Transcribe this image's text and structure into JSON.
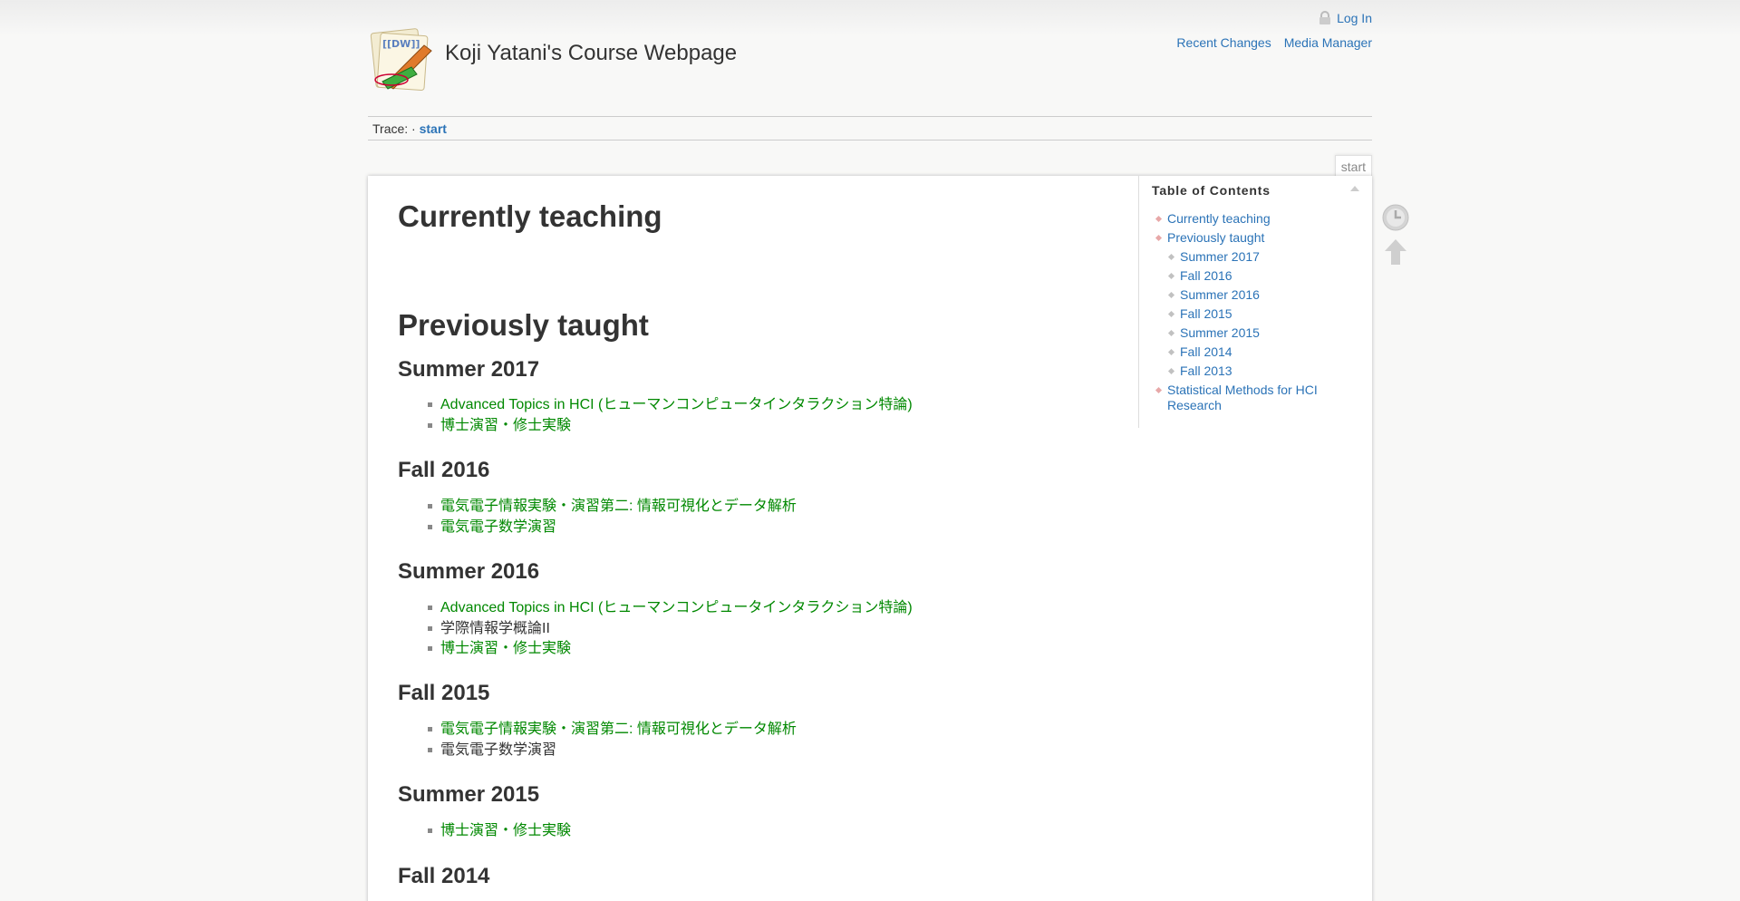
{
  "header": {
    "title": "Koji Yatani's Course Webpage",
    "user_tools": {
      "login": "Log In"
    },
    "site_tools": {
      "recent_changes": "Recent Changes",
      "media_manager": "Media Manager"
    }
  },
  "breadcrumbs": {
    "label": "Trace:",
    "separator": "·",
    "current": "start"
  },
  "page_id": "start",
  "content": {
    "h_current": "Currently teaching",
    "h_previous": "Previously taught",
    "sections": [
      {
        "title": "Summer 2017",
        "items": [
          {
            "text": "Advanced Topics in HCI (ヒューマンコンピュータインタラクション特論)",
            "link": true
          },
          {
            "text": "博士演習・修士実験",
            "link": true
          }
        ]
      },
      {
        "title": "Fall 2016",
        "items": [
          {
            "text": "電気電子情報実験・演習第二: 情報可視化とデータ解析",
            "link": true
          },
          {
            "text": "電気電子数学演習",
            "link": true
          }
        ]
      },
      {
        "title": "Summer 2016",
        "items": [
          {
            "text": "Advanced Topics in HCI (ヒューマンコンピュータインタラクション特論)",
            "link": true
          },
          {
            "text": "学際情報学概論II",
            "link": false
          },
          {
            "text": "博士演習・修士実験",
            "link": true
          }
        ]
      },
      {
        "title": "Fall 2015",
        "items": [
          {
            "text": "電気電子情報実験・演習第二: 情報可視化とデータ解析",
            "link": true
          },
          {
            "text": "電気電子数学演習",
            "link": false
          }
        ]
      },
      {
        "title": "Summer 2015",
        "items": [
          {
            "text": "博士演習・修士実験",
            "link": true
          }
        ]
      },
      {
        "title": "Fall 2014",
        "items": []
      }
    ]
  },
  "toc": {
    "title": "Table of Contents",
    "items": [
      {
        "label": "Currently teaching",
        "level": 1
      },
      {
        "label": "Previously taught",
        "level": 1
      },
      {
        "label": "Summer 2017",
        "level": 2
      },
      {
        "label": "Fall 2016",
        "level": 2
      },
      {
        "label": "Summer 2016",
        "level": 2
      },
      {
        "label": "Fall 2015",
        "level": 2
      },
      {
        "label": "Summer 2015",
        "level": 2
      },
      {
        "label": "Fall 2014",
        "level": 2
      },
      {
        "label": "Fall 2013",
        "level": 2
      },
      {
        "label": "Statistical Methods for HCI Research",
        "level": 1
      }
    ]
  },
  "colors": {
    "link": "#2b73b7",
    "content_link": "#008800",
    "text": "#333333"
  },
  "icons": {
    "logo": "dokuwiki-logo",
    "lock": "lock-icon",
    "revisions": "clock-icon",
    "top": "arrow-up-icon"
  }
}
